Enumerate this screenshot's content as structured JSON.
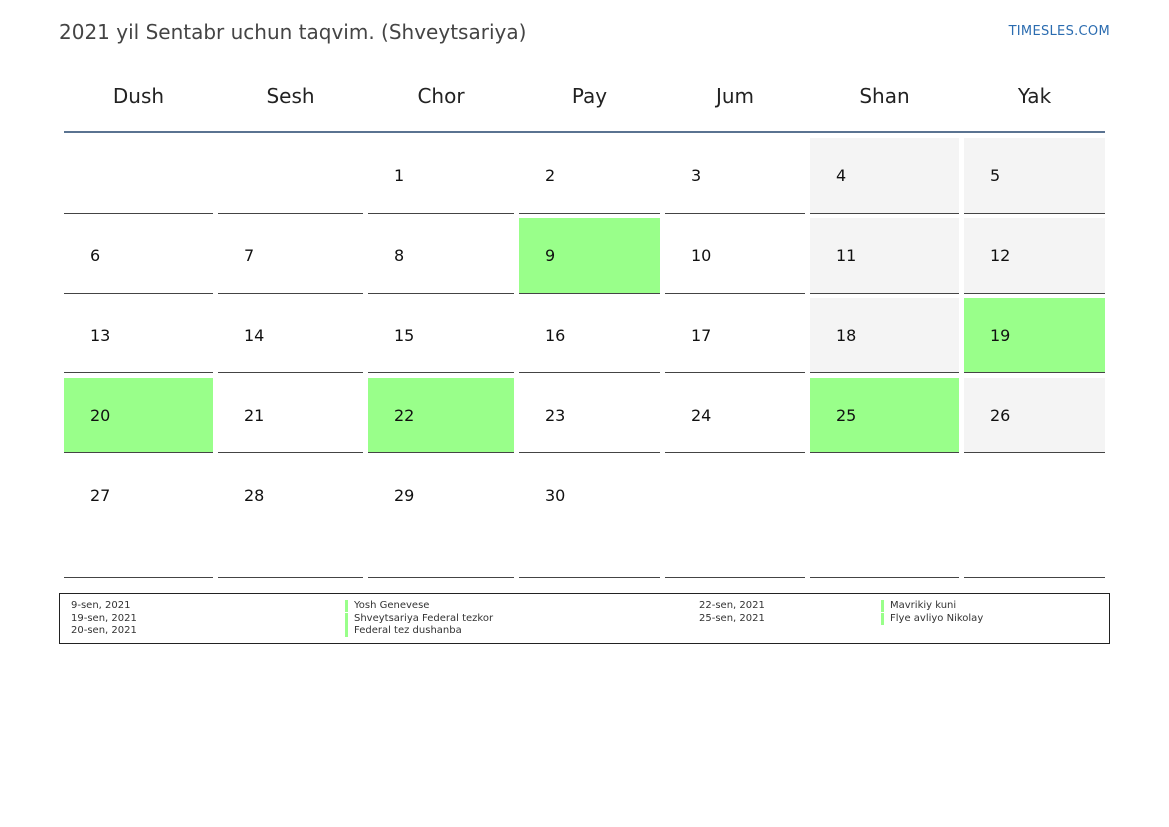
{
  "header": {
    "title": "2021 yil Sentabr uchun taqvim. (Shveytsariya)",
    "brand": "TIMESLES.COM"
  },
  "weekdays": [
    "Dush",
    "Sesh",
    "Chor",
    "Pay",
    "Jum",
    "Shan",
    "Yak"
  ],
  "colors": {
    "holiday": "#99ff8a",
    "weekend": "#f4f4f4",
    "rule": "#5a7391",
    "brand": "#2b6cb0"
  },
  "weeks": [
    [
      null,
      null,
      1,
      2,
      3,
      4,
      5
    ],
    [
      6,
      7,
      8,
      9,
      10,
      11,
      12
    ],
    [
      13,
      14,
      15,
      16,
      17,
      18,
      19
    ],
    [
      20,
      21,
      22,
      23,
      24,
      25,
      26
    ],
    [
      27,
      28,
      29,
      30,
      null,
      null,
      null
    ]
  ],
  "holiday_days": [
    9,
    19,
    20,
    22,
    25
  ],
  "legend": {
    "left": [
      {
        "date": "9-sen, 2021",
        "name": "Yosh Genevese"
      },
      {
        "date": "19-sen, 2021",
        "name": "Shveytsariya Federal tezkor"
      },
      {
        "date": "20-sen, 2021",
        "name": "Federal tez dushanba"
      }
    ],
    "right": [
      {
        "date": "22-sen, 2021",
        "name": "Mavrikiy kuni"
      },
      {
        "date": "25-sen, 2021",
        "name": "Flye avliyo Nikolay"
      }
    ]
  }
}
